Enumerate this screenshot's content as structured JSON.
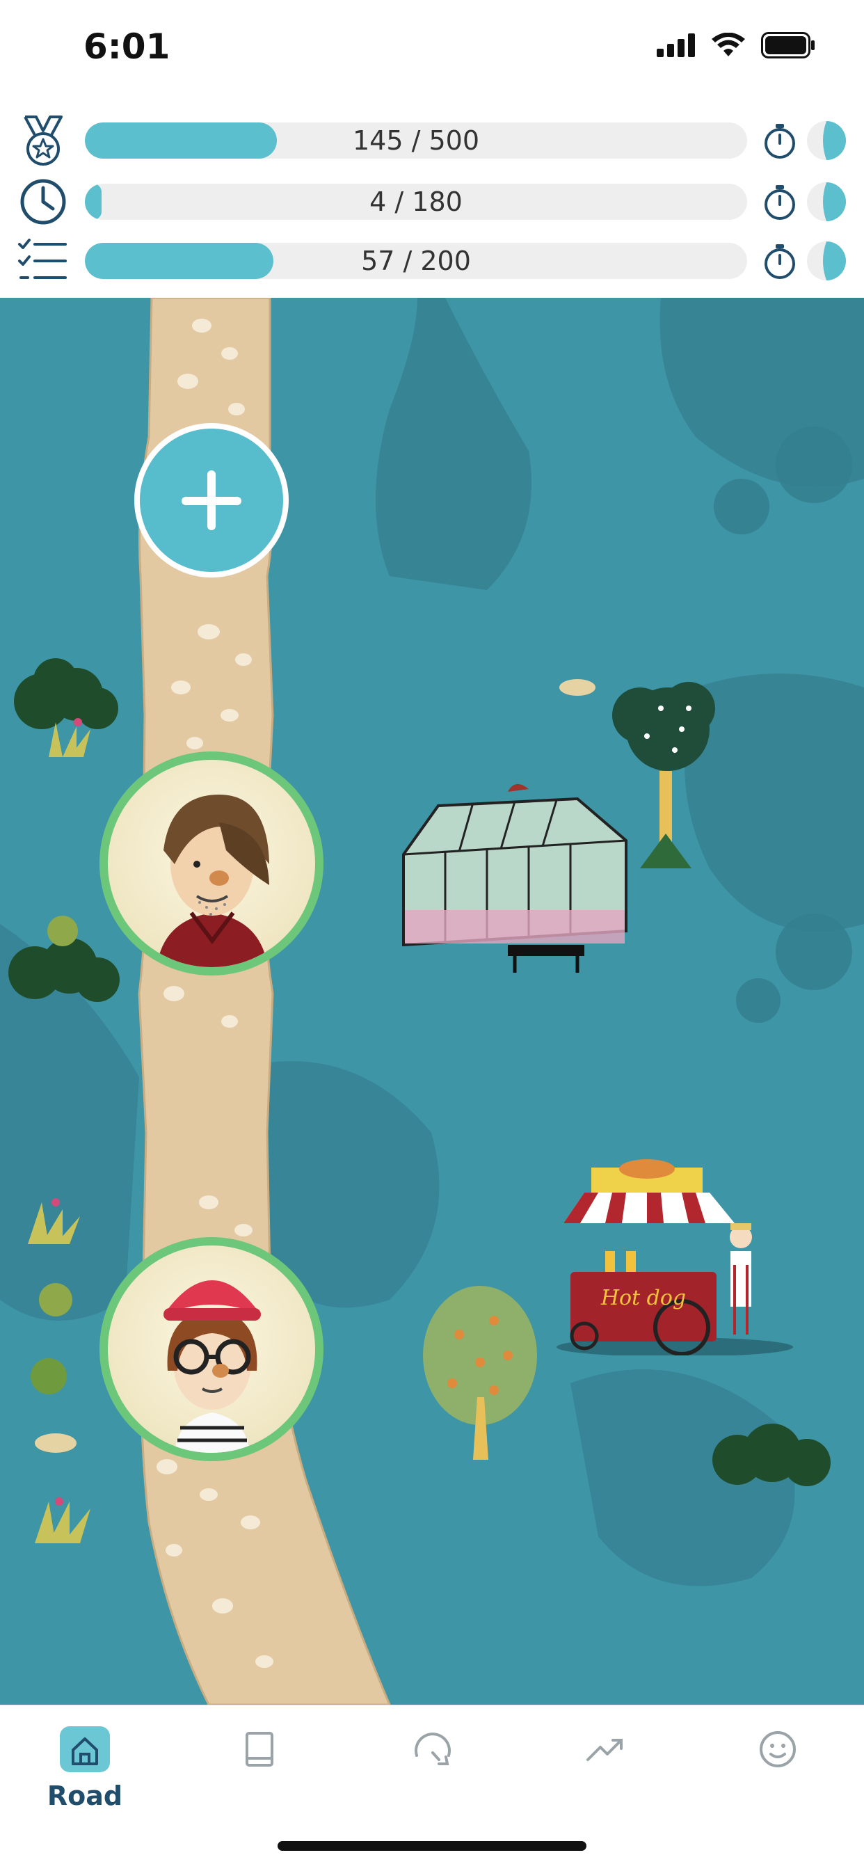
{
  "status_bar": {
    "time": "6:01"
  },
  "progress": [
    {
      "icon": "medal-icon",
      "text": "145 / 500",
      "value": 145,
      "max": 500
    },
    {
      "icon": "clock-icon",
      "text": "4 / 180",
      "value": 4,
      "max": 180
    },
    {
      "icon": "checklist-icon",
      "text": "57 / 200",
      "value": 57,
      "max": 200
    }
  ],
  "map": {
    "add_button_icon": "plus-icon",
    "avatars": [
      "avatar-man-brown-hair",
      "avatar-girl-red-hat-glasses"
    ],
    "cart_sign": "Hot dog"
  },
  "tabs": [
    {
      "label": "Road",
      "icon": "home-icon",
      "active": true
    },
    {
      "label": "",
      "icon": "book-icon",
      "active": false
    },
    {
      "label": "",
      "icon": "speedometer-icon",
      "active": false
    },
    {
      "label": "",
      "icon": "trend-icon",
      "active": false
    },
    {
      "label": "",
      "icon": "smiley-icon",
      "active": false
    }
  ],
  "colors": {
    "accent": "#5bbfcd",
    "map_water": "#3d95a6",
    "avatar_ring": "#6dc77a",
    "tab_label": "#1f4d6b"
  }
}
